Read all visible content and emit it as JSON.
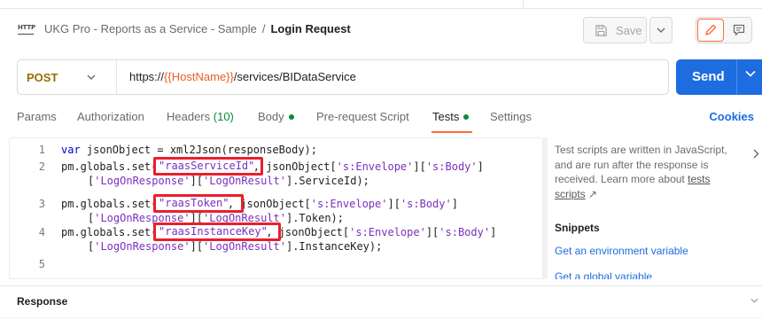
{
  "header": {
    "icon_text": "HTTP",
    "collection": "UKG Pro - Reports as a Service - Sample",
    "separator": "/",
    "request_name": "Login Request",
    "save_label": "Save"
  },
  "request": {
    "method": "POST",
    "url_prefix": "https://",
    "url_variable": "{{HostName}}",
    "url_suffix": "/services/BIDataService",
    "send_label": "Send"
  },
  "tabs": {
    "params": "Params",
    "authorization": "Authorization",
    "headers": "Headers",
    "headers_count": "(10)",
    "body": "Body",
    "prerequest": "Pre-request Script",
    "tests": "Tests",
    "settings": "Settings",
    "cookies": "Cookies",
    "active": "Tests"
  },
  "editor": {
    "line_numbers": [
      "1",
      "2",
      "3",
      "4",
      "5"
    ],
    "l1_kw": "var",
    "l1_rest": " jsonObject = xml2Json(responseBody);",
    "l2_a": "pm.globals.set(",
    "l2_key": "\"raasServiceId\"",
    "l2_b": ", jsonObject[",
    "l2_s1": "'s:Envelope'",
    "l2_c": "][",
    "l2_s2": "'s:Body'",
    "l2_d": "]",
    "l2w_a": "[",
    "l2w_s1": "'LogOnResponse'",
    "l2w_b": "][",
    "l2w_s2": "'LogOnResult'",
    "l2w_c": "].ServiceId);",
    "l3_a": "pm.globals.set(",
    "l3_key": "\"raasToken\"",
    "l3_b": ", jsonObject[",
    "l3_s1": "'s:Envelope'",
    "l3_c": "][",
    "l3_s2": "'s:Body'",
    "l3_d": "]",
    "l3w_a": "[",
    "l3w_s1": "'LogOnResponse'",
    "l3w_b": "][",
    "l3w_s2": "'LogOnResult'",
    "l3w_c": "].Token);",
    "l4_a": "pm.globals.set(",
    "l4_key": "\"raasInstanceKey\"",
    "l4_b": ", jsonObject[",
    "l4_s1": "'s:Envelope'",
    "l4_c": "][",
    "l4_s2": "'s:Body'",
    "l4_d": "]",
    "l4w_a": "[",
    "l4w_s1": "'LogOnResponse'",
    "l4w_b": "][",
    "l4w_s2": "'LogOnResult'",
    "l4w_c": "].InstanceKey);"
  },
  "side": {
    "description": "Test scripts are written in JavaScript, and are run after the response is received. Learn more about",
    "link": "tests scripts",
    "link_arrow": "↗",
    "snippets_title": "Snippets",
    "snippets": [
      "Get an environment variable",
      "Get a global variable"
    ]
  },
  "response": {
    "title": "Response"
  },
  "colors": {
    "accent": "#ff6c37",
    "send": "#1d6ce0",
    "method": "#9a6b00",
    "highlight": "#e8202a",
    "status_green": "#0c8a3a"
  }
}
